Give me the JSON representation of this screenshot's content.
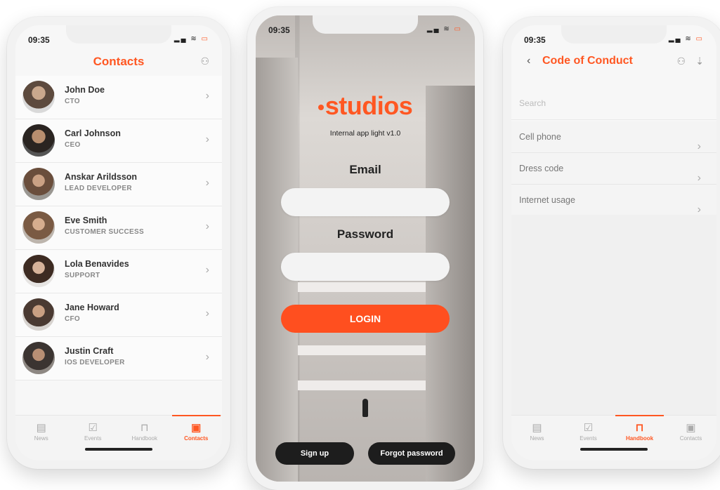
{
  "contacts_screen": {
    "time": "09:35",
    "title": "Contacts",
    "contacts": [
      {
        "name": "John Doe",
        "role": "CTO"
      },
      {
        "name": "Carl Johnson",
        "role": "CEO"
      },
      {
        "name": "Anskar Arildsson",
        "role": "LEAD DEVELOPER"
      },
      {
        "name": "Eve Smith",
        "role": "CUSTOMER SUCCESS"
      },
      {
        "name": "Lola Benavides",
        "role": "SUPPORT"
      },
      {
        "name": "Jane Howard",
        "role": "CFO"
      },
      {
        "name": "Justin Craft",
        "role": "IOS DEVELOPER"
      }
    ],
    "tabs": [
      {
        "label": "News"
      },
      {
        "label": "Events"
      },
      {
        "label": "Handbook"
      },
      {
        "label": "Contacts",
        "active": true
      }
    ]
  },
  "login_screen": {
    "time": "09:35",
    "brand": "studios",
    "subtitle": "Internal app light v1.0",
    "email_label": "Email",
    "password_label": "Password",
    "login_button": "LOGIN",
    "signup_button": "Sign up",
    "forgot_button": "Forgot password"
  },
  "conduct_screen": {
    "time": "09:35",
    "title": "Code of Conduct",
    "search_placeholder": "Search",
    "items": [
      {
        "label": "Cell phone"
      },
      {
        "label": "Dress code"
      },
      {
        "label": "Internet usage"
      }
    ],
    "tabs": [
      {
        "label": "News"
      },
      {
        "label": "Events"
      },
      {
        "label": "Handbook",
        "active": true
      },
      {
        "label": "Contacts"
      }
    ]
  },
  "colors": {
    "accent": "#ff5722",
    "dark_button": "#1d1d1d"
  }
}
